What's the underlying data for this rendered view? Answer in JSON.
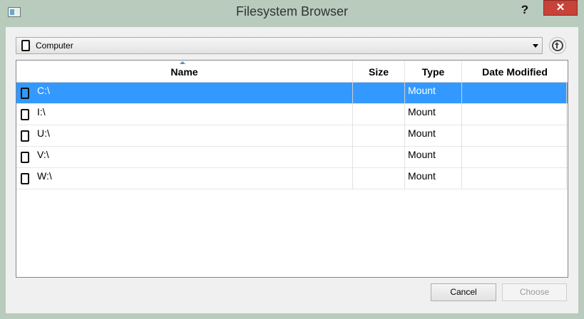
{
  "window": {
    "title": "Filesystem Browser",
    "help_label": "?",
    "close_label": "✕"
  },
  "location": {
    "value": "Computer",
    "icon": "drive-icon"
  },
  "table": {
    "columns": [
      "Name",
      "Size",
      "Type",
      "Date Modified"
    ],
    "sort_column": "Name",
    "rows": [
      {
        "name": "C:\\",
        "size": "",
        "type": "Mount",
        "date": "",
        "selected": true
      },
      {
        "name": "I:\\",
        "size": "",
        "type": "Mount",
        "date": "",
        "selected": false
      },
      {
        "name": "U:\\",
        "size": "",
        "type": "Mount",
        "date": "",
        "selected": false
      },
      {
        "name": "V:\\",
        "size": "",
        "type": "Mount",
        "date": "",
        "selected": false
      },
      {
        "name": "W:\\",
        "size": "",
        "type": "Mount",
        "date": "",
        "selected": false
      }
    ]
  },
  "buttons": {
    "cancel": "Cancel",
    "choose": "Choose",
    "choose_enabled": false
  },
  "colors": {
    "selection": "#3399ff",
    "close_button": "#c7433a",
    "frame": "#b8cbbd"
  }
}
